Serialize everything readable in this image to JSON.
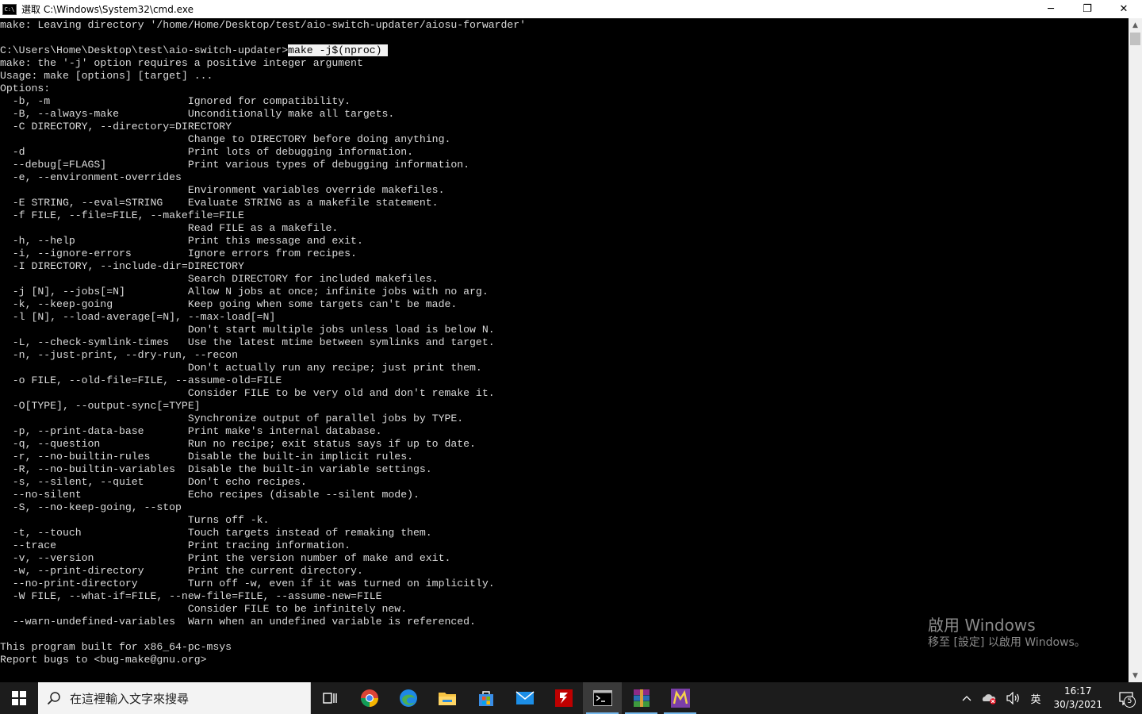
{
  "window": {
    "title": "選取 C:\\Windows\\System32\\cmd.exe",
    "minimize_glyph": "─",
    "maximize_glyph": "❐",
    "close_glyph": "✕"
  },
  "console": {
    "selected_text": "make -j$(nproc) ",
    "prompt_prefix": "C:\\Users\\Home\\Desktop\\test\\aio-switch-updater>",
    "lines": [
      "make: Leaving directory '/home/Home/Desktop/test/aio-switch-updater/aiosu-forwarder'",
      "",
      "",
      "make: the '-j' option requires a positive integer argument",
      "Usage: make [options] [target] ...",
      "Options:",
      "  -b, -m                      Ignored for compatibility.",
      "  -B, --always-make           Unconditionally make all targets.",
      "  -C DIRECTORY, --directory=DIRECTORY",
      "                              Change to DIRECTORY before doing anything.",
      "  -d                          Print lots of debugging information.",
      "  --debug[=FLAGS]             Print various types of debugging information.",
      "  -e, --environment-overrides",
      "                              Environment variables override makefiles.",
      "  -E STRING, --eval=STRING    Evaluate STRING as a makefile statement.",
      "  -f FILE, --file=FILE, --makefile=FILE",
      "                              Read FILE as a makefile.",
      "  -h, --help                  Print this message and exit.",
      "  -i, --ignore-errors         Ignore errors from recipes.",
      "  -I DIRECTORY, --include-dir=DIRECTORY",
      "                              Search DIRECTORY for included makefiles.",
      "  -j [N], --jobs[=N]          Allow N jobs at once; infinite jobs with no arg.",
      "  -k, --keep-going            Keep going when some targets can't be made.",
      "  -l [N], --load-average[=N], --max-load[=N]",
      "                              Don't start multiple jobs unless load is below N.",
      "  -L, --check-symlink-times   Use the latest mtime between symlinks and target.",
      "  -n, --just-print, --dry-run, --recon",
      "                              Don't actually run any recipe; just print them.",
      "  -o FILE, --old-file=FILE, --assume-old=FILE",
      "                              Consider FILE to be very old and don't remake it.",
      "  -O[TYPE], --output-sync[=TYPE]",
      "                              Synchronize output of parallel jobs by TYPE.",
      "  -p, --print-data-base       Print make's internal database.",
      "  -q, --question              Run no recipe; exit status says if up to date.",
      "  -r, --no-builtin-rules      Disable the built-in implicit rules.",
      "  -R, --no-builtin-variables  Disable the built-in variable settings.",
      "  -s, --silent, --quiet       Don't echo recipes.",
      "  --no-silent                 Echo recipes (disable --silent mode).",
      "  -S, --no-keep-going, --stop",
      "                              Turns off -k.",
      "  -t, --touch                 Touch targets instead of remaking them.",
      "  --trace                     Print tracing information.",
      "  -v, --version               Print the version number of make and exit.",
      "  -w, --print-directory       Print the current directory.",
      "  --no-print-directory        Turn off -w, even if it was turned on implicitly.",
      "  -W FILE, --what-if=FILE, --new-file=FILE, --assume-new=FILE",
      "                              Consider FILE to be infinitely new.",
      "  --warn-undefined-variables  Warn when an undefined variable is referenced.",
      "",
      "This program built for x86_64-pc-msys",
      "Report bugs to <bug-make@gnu.org>"
    ]
  },
  "watermark": {
    "line1": "啟用 Windows",
    "line2": "移至 [設定] 以啟用 Windows。"
  },
  "taskbar": {
    "search_placeholder": "在這裡輸入文字來搜尋",
    "apps": [
      {
        "name": "task-view",
        "icon": "task-view-icon"
      },
      {
        "name": "chrome",
        "icon": "chrome-icon"
      },
      {
        "name": "edge",
        "icon": "edge-icon"
      },
      {
        "name": "file-explorer",
        "icon": "folder-icon"
      },
      {
        "name": "microsoft-store",
        "icon": "store-icon"
      },
      {
        "name": "mail",
        "icon": "mail-icon"
      },
      {
        "name": "filezilla",
        "icon": "filezilla-icon"
      },
      {
        "name": "command-prompt",
        "icon": "cmd-icon"
      },
      {
        "name": "winrar",
        "icon": "winrar-icon"
      },
      {
        "name": "app-m",
        "icon": "app-m-icon"
      }
    ],
    "tray": {
      "chevron": "^",
      "volume": "🕪",
      "ime": "英",
      "time": "16:17",
      "date": "30/3/2021",
      "notification_count": "5"
    }
  }
}
